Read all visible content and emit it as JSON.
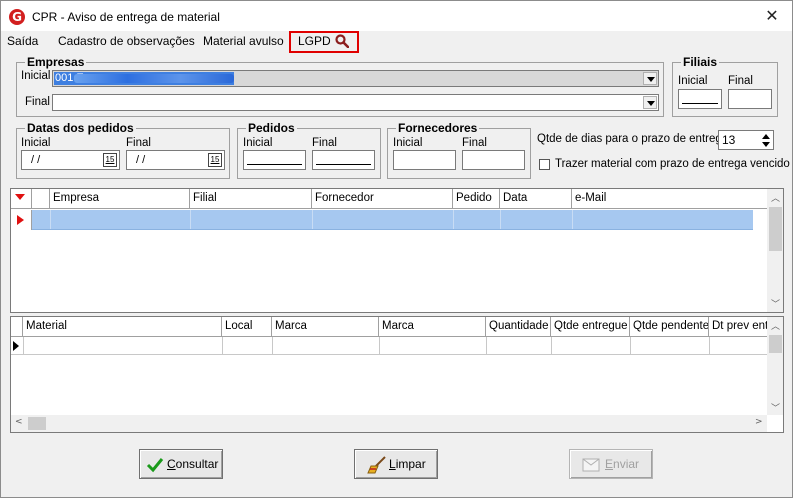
{
  "window": {
    "title": "CPR - Aviso de entrega de material",
    "logo_letter": "G"
  },
  "menu": {
    "items": [
      "Saída",
      "Cadastro de observações",
      "Material avulso",
      "LGPD"
    ]
  },
  "empresas": {
    "legend": "Empresas",
    "inicial_label": "Inicial",
    "inicial_value": "001 E",
    "final_label": "Final",
    "final_value": ""
  },
  "filiais": {
    "legend": "Filiais",
    "inicial_label": "Inicial",
    "final_label": "Final"
  },
  "datas": {
    "legend": "Datas dos pedidos",
    "inicial_label": "Inicial",
    "final_label": "Final",
    "inicial_value": "/ /",
    "final_value": "/ /",
    "cal_icon_text": "15"
  },
  "pedidos": {
    "legend": "Pedidos",
    "inicial_label": "Inicial",
    "final_label": "Final"
  },
  "fornecedores": {
    "legend": "Fornecedores",
    "inicial_label": "Inicial",
    "final_label": "Final"
  },
  "prazo": {
    "label": "Qtde de dias para o prazo de entrega",
    "value": "13",
    "checkbox_label": "Trazer material com prazo de entrega vencido",
    "checkbox_checked": false
  },
  "grid_top": {
    "columns": [
      "Empresa",
      "Filial",
      "Fornecedor",
      "Pedido",
      "Data",
      "e-Mail"
    ]
  },
  "grid_bottom": {
    "columns": [
      "Material",
      "Local",
      "Marca",
      "Marca",
      "Quantidade",
      "Qtde entregue",
      "Qtde pendente",
      "Dt prev ent"
    ]
  },
  "buttons": {
    "consultar": {
      "underline": "C",
      "rest": "onsultar"
    },
    "limpar": {
      "underline": "L",
      "rest": "impar"
    },
    "enviar": {
      "underline": "E",
      "rest": "nviar"
    }
  },
  "colors": {
    "selected_row": "#a6c8f0",
    "highlight_border": "#e00000",
    "selection_blue": "#3e7fe0"
  }
}
